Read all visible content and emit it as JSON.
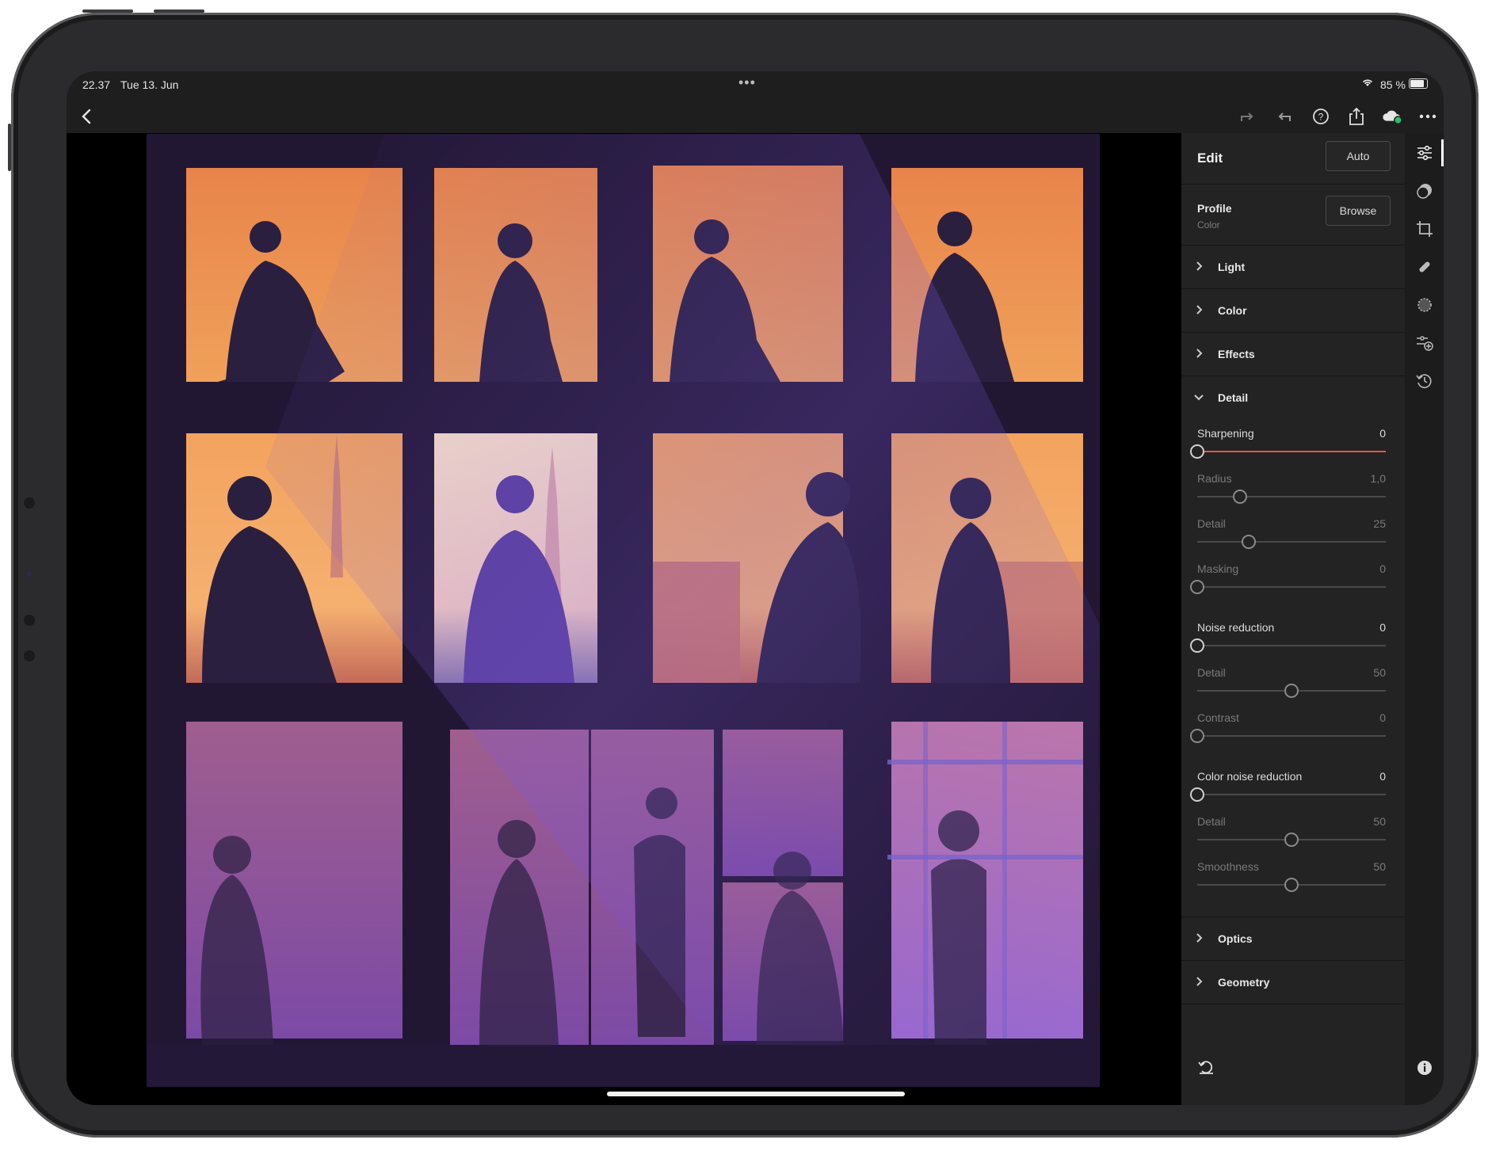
{
  "status_bar": {
    "time": "22.37",
    "date": "Tue 13. Jun",
    "battery": "85 %"
  },
  "toolbar": {
    "icons": [
      "back-icon",
      "redo-icon",
      "undo-icon",
      "help-icon",
      "share-icon",
      "cloud-sync-icon",
      "more-icon"
    ]
  },
  "panel": {
    "title": "Edit",
    "auto_label": "Auto",
    "profile": {
      "label": "Profile",
      "value": "Color",
      "browse_label": "Browse"
    },
    "sections": {
      "light": "Light",
      "color": "Color",
      "effects": "Effects",
      "detail": "Detail",
      "optics": "Optics",
      "geometry": "Geometry"
    },
    "detail": {
      "sharpening": {
        "label": "Sharpening",
        "value": "0"
      },
      "radius": {
        "label": "Radius",
        "value": "1,0"
      },
      "sharp_detail": {
        "label": "Detail",
        "value": "25"
      },
      "masking": {
        "label": "Masking",
        "value": "0"
      },
      "noise_reduction": {
        "label": "Noise reduction",
        "value": "0"
      },
      "nr_detail": {
        "label": "Detail",
        "value": "50"
      },
      "nr_contrast": {
        "label": "Contrast",
        "value": "0"
      },
      "color_noise_reduction": {
        "label": "Color noise reduction",
        "value": "0"
      },
      "cnr_detail": {
        "label": "Detail",
        "value": "50"
      },
      "cnr_smoothness": {
        "label": "Smoothness",
        "value": "50"
      }
    }
  },
  "rail": {
    "icons": [
      "adjust-icon",
      "presets-icon",
      "crop-icon",
      "heal-icon",
      "masking-icon",
      "versions-icon",
      "history-icon"
    ]
  },
  "colors": {
    "accent_line": "#e0584a",
    "panel_bg": "#232323",
    "canvas_bg": "#000000"
  }
}
